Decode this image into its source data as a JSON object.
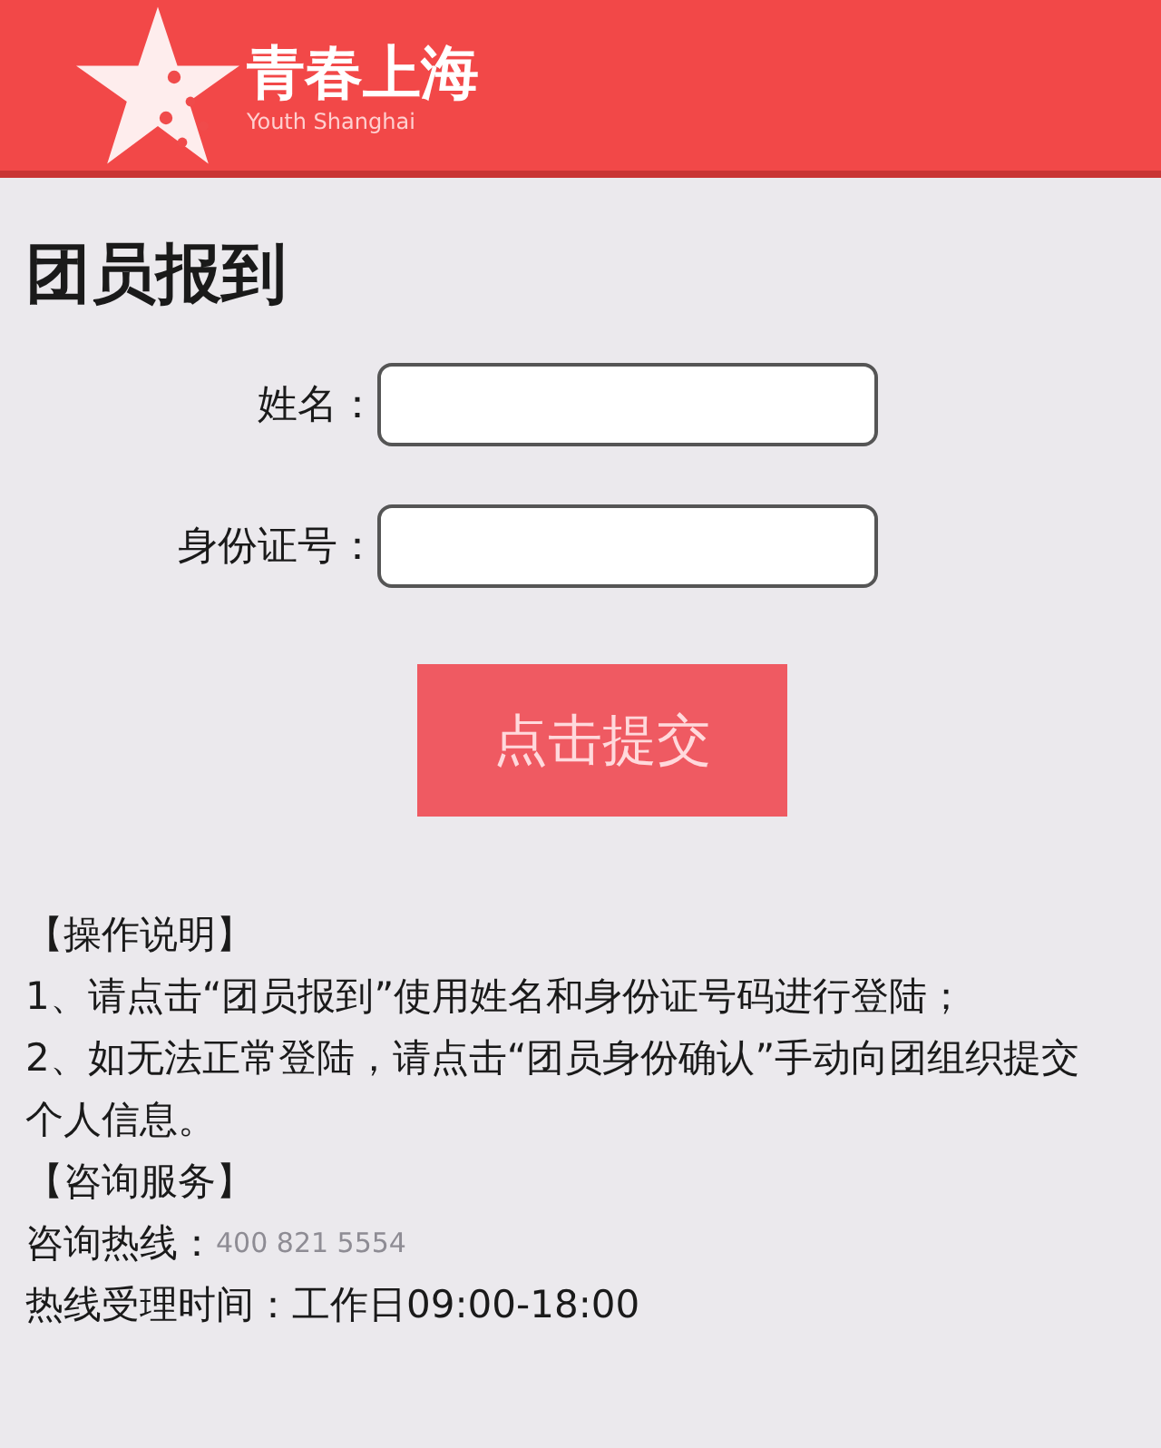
{
  "header": {
    "logo_title": "青春上海",
    "logo_subtitle": "Youth Shanghai"
  },
  "page_title": "团员报到",
  "form": {
    "fields": [
      {
        "label": "姓名："
      },
      {
        "label": "身份证号："
      }
    ],
    "submit": "点击提交"
  },
  "instructions": [
    {
      "kind": "heading",
      "text": "【操作说明】"
    },
    {
      "kind": "line",
      "text": "1、请点击“团员报到”使用姓名和身份证号码进行登陆；"
    },
    {
      "kind": "line",
      "text": "2、如无法正常登陆，请点击“团员身份确认”手动向团组织提交个人信息。"
    },
    {
      "kind": "heading",
      "text": "【咨询服务】"
    },
    {
      "kind": "contact",
      "label": "咨询热线：",
      "value": "400 821 5554"
    },
    {
      "kind": "contact",
      "label": "热线受理时间：",
      "value": "工作日09:00-18:00"
    }
  ]
}
